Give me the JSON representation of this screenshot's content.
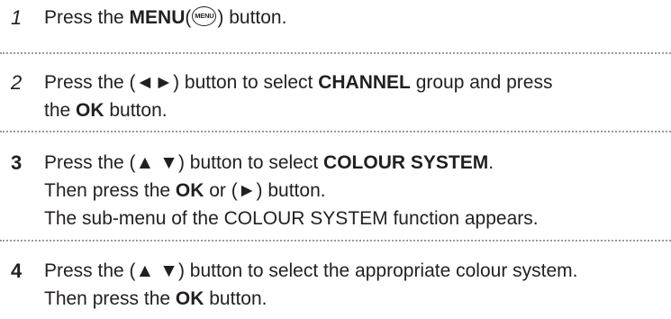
{
  "steps": [
    {
      "number": "1",
      "lines": [
        [
          {
            "t": "Press the "
          },
          {
            "t": "MENU",
            "b": true
          },
          {
            "t": "("
          },
          {
            "icon": "menu-button-icon",
            "label": "MENU"
          },
          {
            "t": ") button."
          }
        ]
      ]
    },
    {
      "number": "2",
      "lines": [
        [
          {
            "t": "Press the (◄►) button to select "
          },
          {
            "t": "CHANNEL",
            "b": true
          },
          {
            "t": " group and press"
          }
        ],
        [
          {
            "t": "the "
          },
          {
            "t": "OK",
            "b": true
          },
          {
            "t": " button."
          }
        ]
      ]
    },
    {
      "number": "3",
      "lines": [
        [
          {
            "t": "Press the (▲ ▼) button to select "
          },
          {
            "t": "COLOUR SYSTEM",
            "b": true
          },
          {
            "t": "."
          }
        ],
        [
          {
            "t": "Then press the "
          },
          {
            "t": "OK",
            "b": true
          },
          {
            "t": " or (►) button."
          }
        ],
        [
          {
            "t": "The sub-menu of the COLOUR SYSTEM function appears."
          }
        ]
      ]
    },
    {
      "number": "4",
      "lines": [
        [
          {
            "t": "Press the (▲ ▼) button to select the appropriate colour system."
          }
        ],
        [
          {
            "t": "Then press the "
          },
          {
            "t": "OK",
            "b": true
          },
          {
            "t": " button."
          }
        ]
      ]
    }
  ]
}
